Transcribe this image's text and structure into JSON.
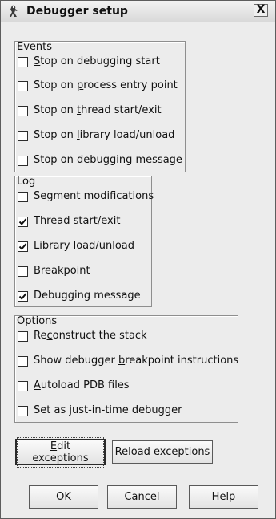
{
  "window": {
    "title": "Debugger setup",
    "close_symbol": "X"
  },
  "events": {
    "label": "Events",
    "items": [
      {
        "pre": "",
        "key": "S",
        "post": "top on debugging start",
        "checked": false
      },
      {
        "pre": "Stop on ",
        "key": "p",
        "post": "rocess entry point",
        "checked": false
      },
      {
        "pre": "Stop on ",
        "key": "t",
        "post": "hread start/exit",
        "checked": false
      },
      {
        "pre": "Stop on ",
        "key": "l",
        "post": "ibrary load/unload",
        "checked": false
      },
      {
        "pre": "Stop on debugging ",
        "key": "m",
        "post": "essage",
        "checked": false
      }
    ]
  },
  "log": {
    "label": "Log",
    "items": [
      {
        "text": "Segment modifications",
        "checked": false
      },
      {
        "text": "Thread start/exit",
        "checked": true
      },
      {
        "text": "Library load/unload",
        "checked": true
      },
      {
        "text": "Breakpoint",
        "checked": false
      },
      {
        "text": "Debugging message",
        "checked": true
      }
    ]
  },
  "options": {
    "label": "Options",
    "items": [
      {
        "pre": "Re",
        "key": "c",
        "post": "onstruct the stack",
        "checked": false
      },
      {
        "pre": "Show debugger ",
        "key": "b",
        "post": "reakpoint instructions",
        "checked": false
      },
      {
        "pre": "",
        "key": "A",
        "post": "utoload PDB files",
        "checked": false
      },
      {
        "pre": "Set as ",
        "key": "j",
        "post": "ust-in-time debugger",
        "checked": false
      }
    ]
  },
  "buttons": {
    "edit_exceptions": {
      "pre": "",
      "key": "E",
      "post": "dit exceptions"
    },
    "reload_exceptions": {
      "pre": "",
      "key": "R",
      "post": "eload exceptions"
    },
    "ok": {
      "pre": "O",
      "key": "K",
      "post": ""
    },
    "cancel": "Cancel",
    "help": "Help"
  },
  "icons": {
    "title_icon": "debugger-app-icon",
    "close_icon": "close-icon",
    "check_icon": "checkmark-icon"
  }
}
